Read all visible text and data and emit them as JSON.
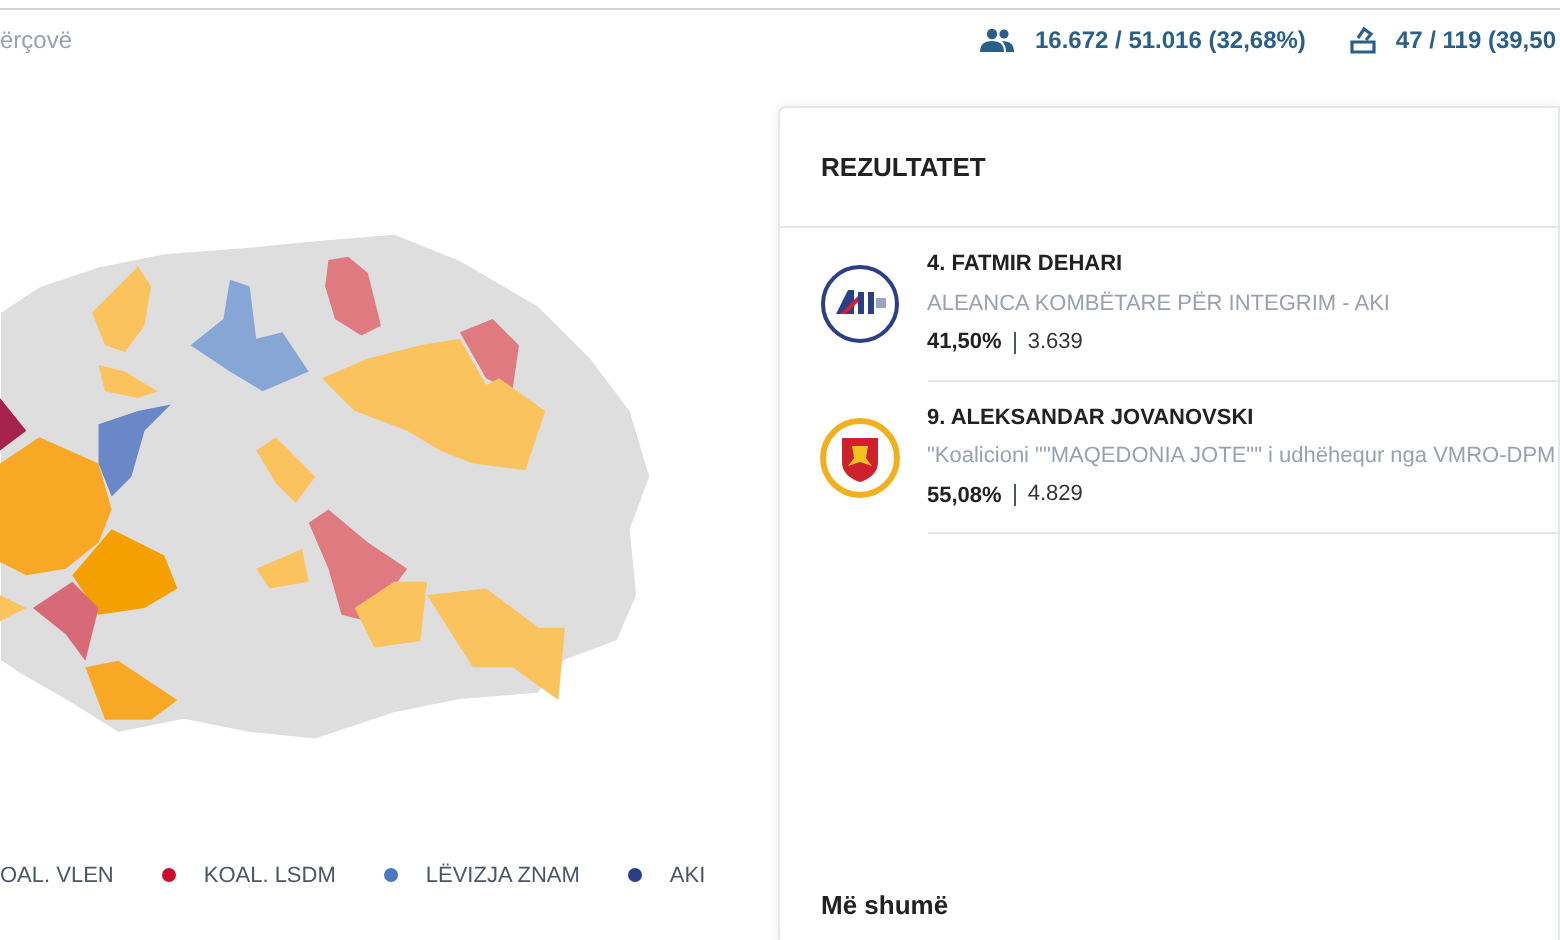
{
  "header": {
    "location": "ërçovë",
    "stats": [
      {
        "kind": "voters",
        "text": "16.672 / 51.016 (32,68%)"
      },
      {
        "kind": "stations",
        "text": "47 / 119 (39,50"
      }
    ]
  },
  "legend": [
    {
      "label": "OAL. VLEN"
    },
    {
      "label": "KOAL. LSDM",
      "color": "#c8102e"
    },
    {
      "label": "LËVIZJA ZNAM",
      "color": "#4a78c2"
    },
    {
      "label": "AKI",
      "color": "#2b3f86"
    }
  ],
  "results": {
    "title": "REZULTATET",
    "candidates": [
      {
        "kind": "aki",
        "name": "4. FATMIR DEHARI",
        "party": "ALEANCA KOMBËTARE PËR INTEGRIM - AKI",
        "percent": "41,50%",
        "votes": "3.639"
      },
      {
        "kind": "vmro",
        "name": "9. ALEKSANDAR JOVANOVSKI",
        "party": "\"Koalicioni \"\"MAQEDONIA JOTE\"\" i udhëhequr nga VMRO-DPM",
        "percent": "55,08%",
        "votes": "4.829"
      }
    ],
    "more": "Më shumë"
  }
}
